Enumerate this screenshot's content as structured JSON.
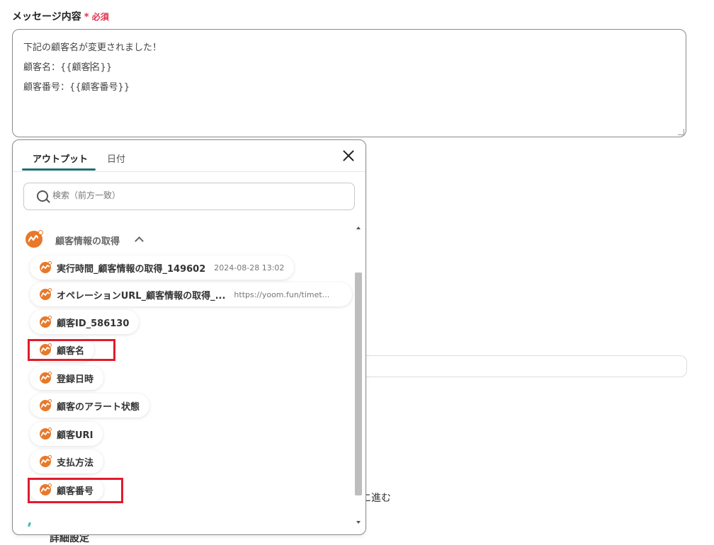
{
  "field": {
    "label": "メッセージ内容",
    "required_mark": "*",
    "required_label": "必須",
    "lines": [
      "下記の顧客名が変更されました！",
      "顧客名：{{顧客",
      "名}}",
      "顧客番号：{{顧客番号}}"
    ]
  },
  "background": {
    "partial_text": "に進む",
    "partial_heading": "詳細設定"
  },
  "panel": {
    "tabs": [
      {
        "label": "アウトプット",
        "active": true
      },
      {
        "label": "日付",
        "active": false
      }
    ],
    "search_placeholder": "検索（前方一致）",
    "section_title": "顧客情報の取得",
    "items": [
      {
        "name": "実行時間_顧客情報の取得_149602",
        "value": "2024-08-28 13:02",
        "highlighted": false
      },
      {
        "name": "オペレーションURL_顧客情報の取得_...",
        "value": "https://yoom.fun/timet...",
        "highlighted": false
      },
      {
        "name": "顧客ID_586130",
        "value": "",
        "highlighted": false
      },
      {
        "name": "顧客名",
        "value": "",
        "highlighted": true
      },
      {
        "name": "登録日時",
        "value": "",
        "highlighted": false
      },
      {
        "name": "顧客のアラート状態",
        "value": "",
        "highlighted": false
      },
      {
        "name": "顧客URI",
        "value": "",
        "highlighted": false
      },
      {
        "name": "支払方法",
        "value": "",
        "highlighted": false
      },
      {
        "name": "顧客番号",
        "value": "",
        "highlighted": true
      }
    ]
  },
  "colors": {
    "accent_tab": "#1f6f76",
    "brand_orange": "#e8792b",
    "highlight_red": "#e01c2c",
    "required_red": "#e0324a"
  }
}
